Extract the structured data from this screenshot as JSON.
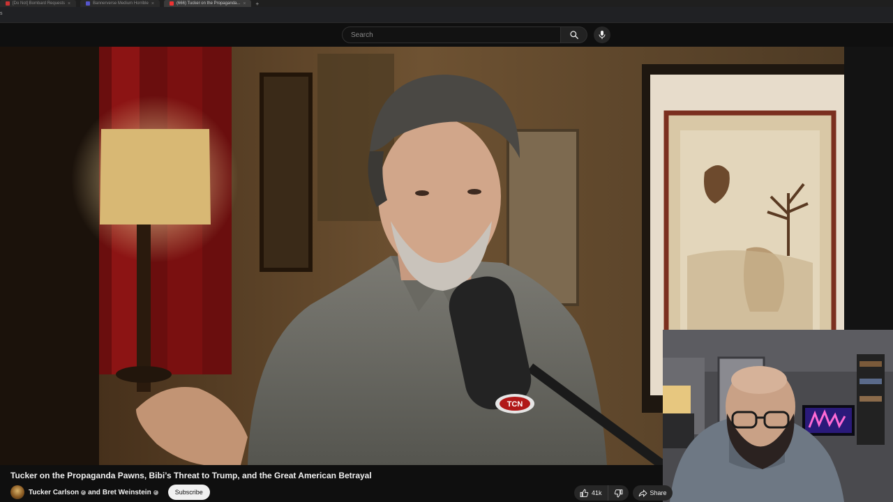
{
  "browser": {
    "tabs": [
      {
        "label": "[Do Not] Bombard Requests",
        "active": false,
        "color": "#c33"
      },
      {
        "label": "Bannerverse Medium Horrible",
        "active": false,
        "color": "#55c"
      },
      {
        "label": "(666) Tucker on the Propaganda...",
        "active": true,
        "color": "#e33"
      }
    ],
    "new_tab_glyph": "+",
    "close_glyph": "×"
  },
  "header": {
    "search_placeholder": "Search",
    "search_icon": "search-icon",
    "mic_icon": "mic-icon"
  },
  "video": {
    "mic_badge": "TCN"
  },
  "info": {
    "title": "Tucker on the Propaganda Pawns, Bibi’s Threat to Trump, and the Great American Betrayal",
    "channel_primary": "Tucker Carlson",
    "channel_joiner": "and",
    "channel_secondary": "Bret Weinstein",
    "subscribe_label": "Subscribe",
    "like_count": "41k",
    "share_label": "Share"
  },
  "colors": {
    "background": "#0f0f0f",
    "text": "#f1f1f1",
    "pill": "#272727",
    "subscribe_bg": "#f1f1f1"
  }
}
